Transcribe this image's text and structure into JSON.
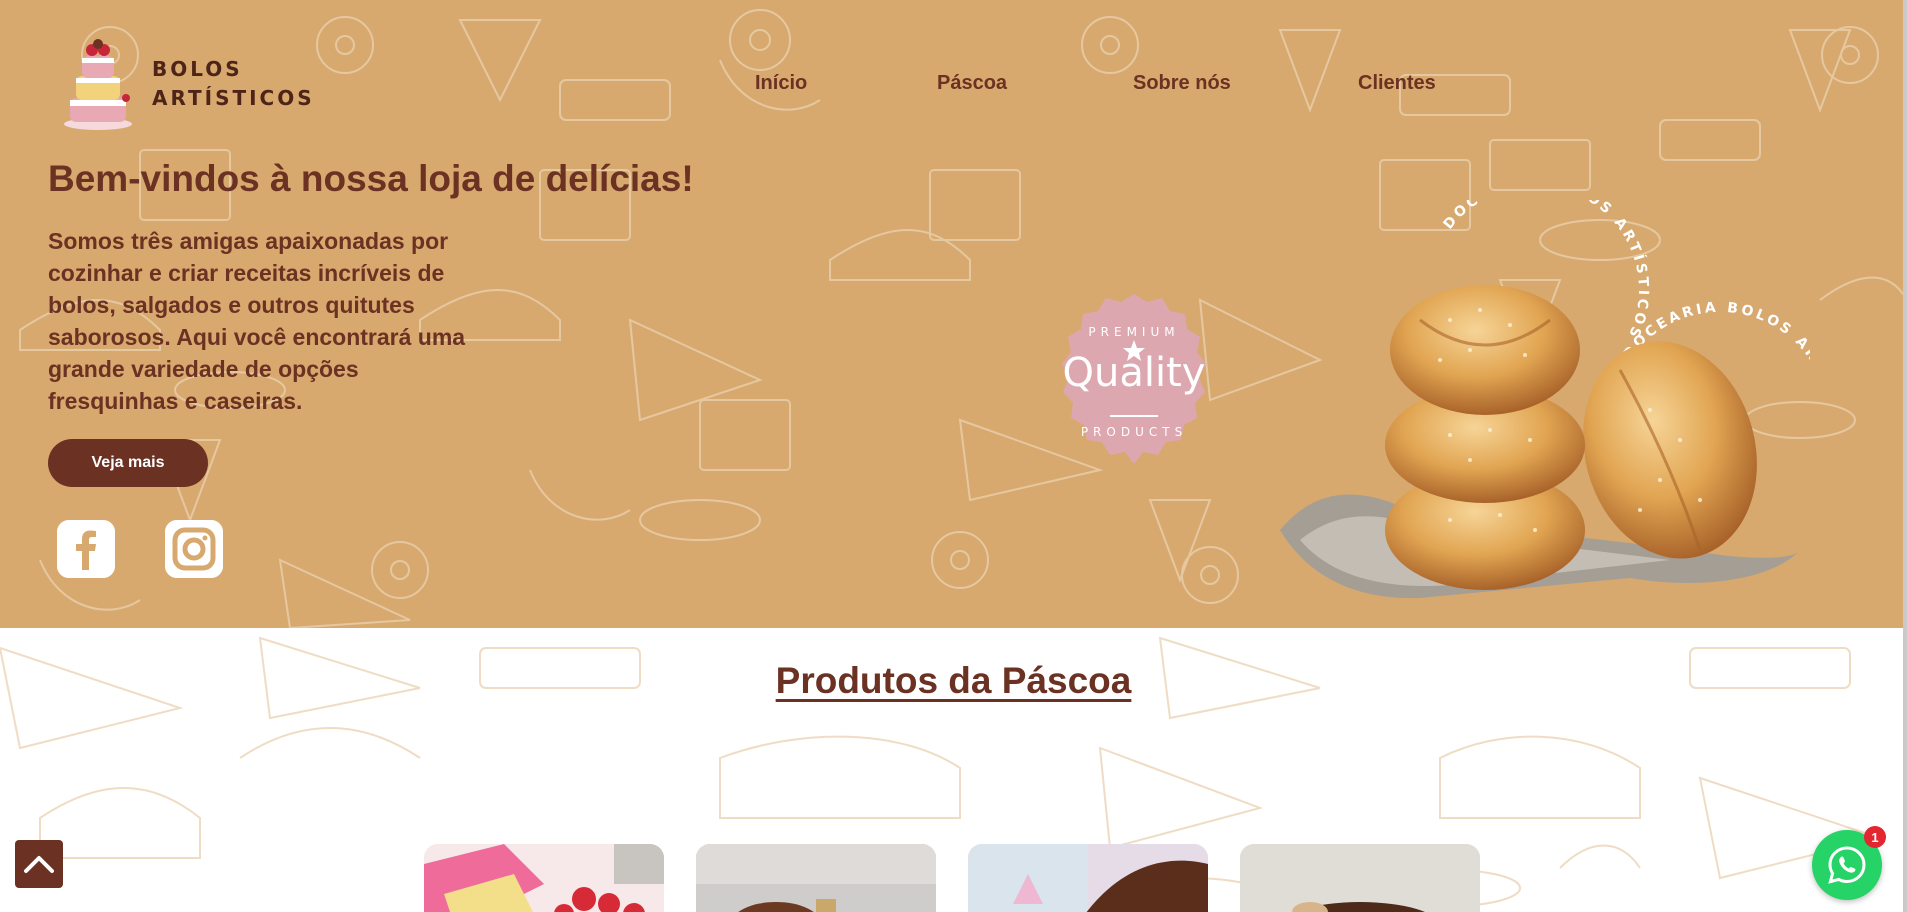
{
  "brand": {
    "line1": "BOLOS",
    "line2": "ARTÍSTICOS"
  },
  "nav": {
    "items": [
      "Início",
      "Páscoa",
      "Sobre nós",
      "Clientes"
    ]
  },
  "hero": {
    "title": "Bem-vindos à nossa loja de delícias!",
    "description": "Somos três amigas apaixonadas por cozinhar e criar receitas incríveis de bolos, salgados e outros quitutes saborosos. Aqui você encontrará uma grande variedade de opções fresquinhas e caseiras.",
    "cta_label": "Veja mais",
    "social": [
      "facebook-icon",
      "instagram-icon"
    ]
  },
  "badge": {
    "top_text": "PREMIUM",
    "main_text": "Quality",
    "bottom_text": "PRODUCTS"
  },
  "circular_text": "DOCEARIA BOLOS ARTÍSTICOS",
  "products": {
    "title": "Produtos da Páscoa"
  },
  "whatsapp": {
    "notification_count": "1"
  },
  "colors": {
    "hero_bg": "#d8a96e",
    "brand_brown": "#6b3122",
    "badge_pink": "#dca7ae",
    "whatsapp_green": "#25d366"
  }
}
